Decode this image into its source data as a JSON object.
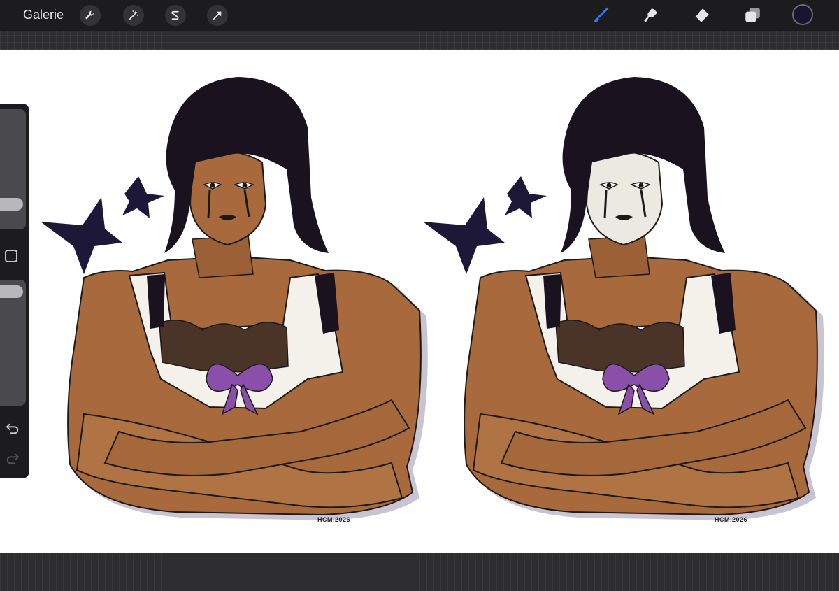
{
  "topbar": {
    "gallery_label": "Galerie",
    "left_tools": [
      {
        "name": "actions",
        "icon": "wrench-icon"
      },
      {
        "name": "adjustments",
        "icon": "magic-wand-icon"
      },
      {
        "name": "selection",
        "icon": "selection-s-icon"
      },
      {
        "name": "transform",
        "icon": "arrow-cursor-icon"
      }
    ],
    "right_tools": [
      {
        "name": "brush",
        "icon": "brush-icon",
        "active": true
      },
      {
        "name": "smudge",
        "icon": "smudge-icon"
      },
      {
        "name": "eraser",
        "icon": "eraser-icon"
      },
      {
        "name": "layers",
        "icon": "layers-icon"
      }
    ],
    "current_color": "#1a1433"
  },
  "colors": {
    "accent": "#2f7cf6",
    "ui_dark": "#1c1c1e",
    "skin": "#a86a3c",
    "hair": "#1b1220",
    "stars": "#1d1838",
    "bow": "#8a4fa8",
    "dress": "#f4f1ea"
  },
  "sidebar": {
    "brush_size_level": 0.62,
    "opacity_level": 0.92,
    "icons": [
      "undo-icon",
      "redo-icon"
    ]
  },
  "artwork": {
    "signatures": [
      "HCM.2026",
      "HCM.2026"
    ]
  }
}
